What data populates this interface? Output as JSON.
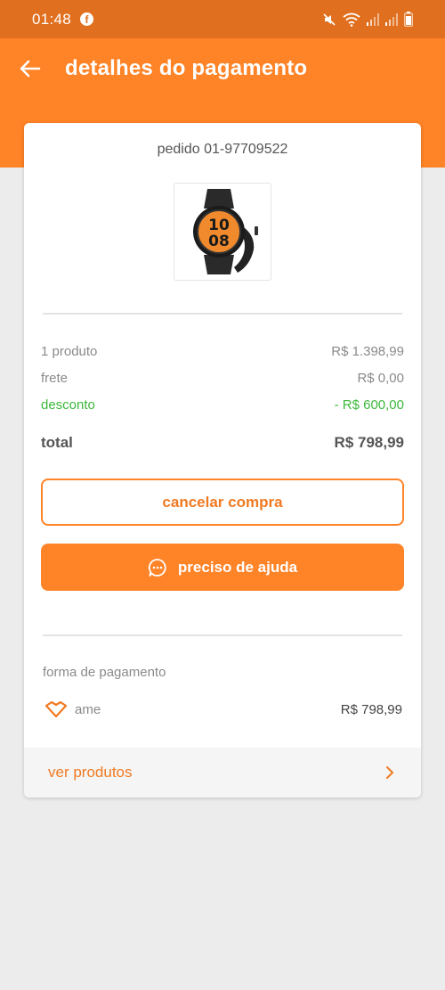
{
  "status_bar": {
    "time": "01:48"
  },
  "header": {
    "title": "detalhes do pagamento"
  },
  "order": {
    "number": "pedido 01-97709522"
  },
  "summary": {
    "product_label": "1 produto",
    "product_value": "R$ 1.398,99",
    "shipping_label": "frete",
    "shipping_value": "R$ 0,00",
    "discount_label": "desconto",
    "discount_value": "- R$ 600,00",
    "total_label": "total",
    "total_value": "R$ 798,99"
  },
  "actions": {
    "cancel_label": "cancelar compra",
    "help_label": "preciso de ajuda"
  },
  "payment": {
    "section_label": "forma de pagamento",
    "method": "ame",
    "amount": "R$ 798,99"
  },
  "footer": {
    "see_products_label": "ver produtos"
  },
  "colors": {
    "primary": "#ff8327",
    "status_bar": "#e0701f",
    "discount": "#3cb83c"
  },
  "icons": [
    "facebook-icon",
    "mute-icon",
    "wifi-icon",
    "signal-icon",
    "battery-icon",
    "back-arrow-icon",
    "chat-icon",
    "ame-heart-icon",
    "chevron-right-icon"
  ]
}
